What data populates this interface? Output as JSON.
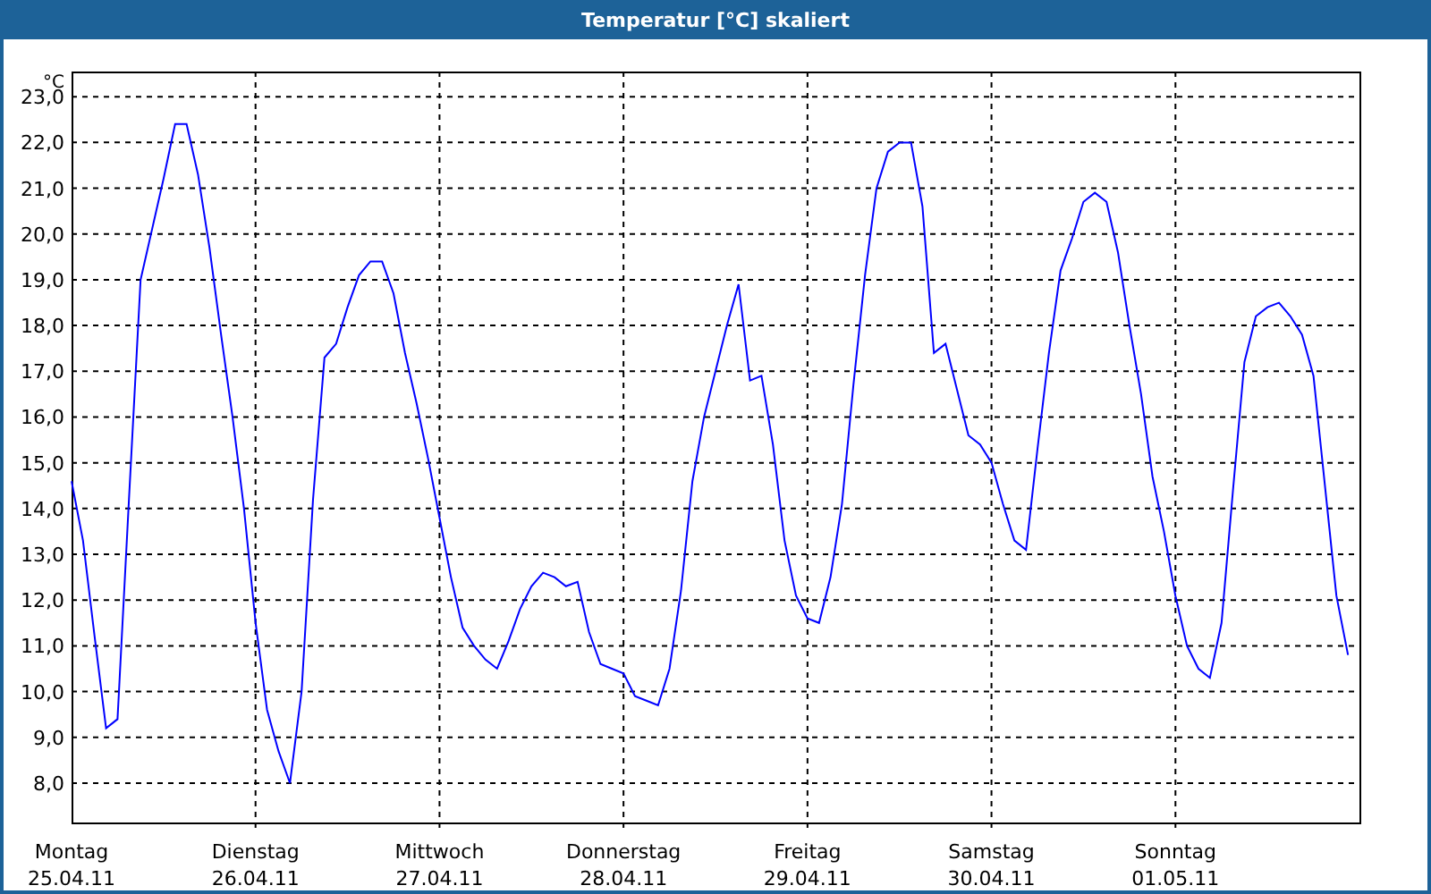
{
  "window": {
    "title": "Temperatur [°C] skaliert"
  },
  "chart": {
    "date_labels": [
      "25.04.11",
      "26.04.11",
      "27.04.11",
      "28.04.11",
      "29.04.11",
      "30.04.11",
      "01.05.11"
    ],
    "chart_data": {
      "type": "line",
      "grid": true,
      "ylabel": "°C",
      "ylim": [
        7.14,
        23.55
      ],
      "yticks": [
        {
          "value": 8,
          "label": "8,0"
        },
        {
          "value": 9,
          "label": "9,0"
        },
        {
          "value": 10,
          "label": "10,0"
        },
        {
          "value": 11,
          "label": "11,0"
        },
        {
          "value": 12,
          "label": "12,0"
        },
        {
          "value": 13,
          "label": "13,0"
        },
        {
          "value": 14,
          "label": "14,0"
        },
        {
          "value": 15,
          "label": "15,0"
        },
        {
          "value": 16,
          "label": "16,0"
        },
        {
          "value": 17,
          "label": "17,0"
        },
        {
          "value": 18,
          "label": "18,0"
        },
        {
          "value": 19,
          "label": "19,0"
        },
        {
          "value": 20,
          "label": "20,0"
        },
        {
          "value": 21,
          "label": "21,0"
        },
        {
          "value": 22,
          "label": "22,0"
        },
        {
          "value": 23,
          "label": "23,0"
        }
      ],
      "categories": [
        "Montag",
        null,
        null,
        null,
        null,
        null,
        null,
        null,
        null,
        null,
        null,
        null,
        null,
        null,
        null,
        null,
        "Dienstag",
        null,
        null,
        null,
        null,
        null,
        null,
        null,
        null,
        null,
        null,
        null,
        null,
        null,
        null,
        null,
        "Mittwoch",
        null,
        null,
        null,
        null,
        null,
        null,
        null,
        null,
        null,
        null,
        null,
        null,
        null,
        null,
        null,
        "Donnerstag",
        null,
        null,
        null,
        null,
        null,
        null,
        null,
        null,
        null,
        null,
        null,
        null,
        null,
        null,
        null,
        "Freitag",
        null,
        null,
        null,
        null,
        null,
        null,
        null,
        null,
        null,
        null,
        null,
        null,
        null,
        null,
        null,
        "Samstag",
        null,
        null,
        null,
        null,
        null,
        null,
        null,
        null,
        null,
        null,
        null,
        null,
        null,
        null,
        null,
        "Sonntag",
        null,
        null,
        null,
        null,
        null,
        null,
        null,
        null,
        null,
        null,
        null,
        null,
        null,
        null,
        null
      ],
      "series": [
        {
          "color": "#0000ff",
          "values": [
            14.6,
            13.3,
            11.2,
            9.2,
            9.4,
            14.2,
            19.0,
            20.1,
            21.2,
            22.4,
            22.4,
            21.3,
            19.7,
            17.8,
            16.0,
            14.0,
            11.5,
            9.6,
            8.7,
            8.0,
            10.0,
            14.2,
            17.3,
            17.6,
            18.4,
            19.1,
            19.4,
            19.4,
            18.7,
            17.4,
            16.3,
            15.1,
            13.8,
            12.5,
            11.4,
            11.0,
            10.7,
            10.5,
            11.1,
            11.8,
            12.3,
            12.6,
            12.5,
            12.3,
            12.4,
            11.3,
            10.6,
            10.5,
            10.4,
            9.9,
            9.8,
            9.7,
            10.5,
            12.2,
            14.6,
            16.0,
            17.0,
            18.0,
            18.9,
            16.8,
            16.9,
            15.4,
            13.3,
            12.1,
            11.6,
            11.5,
            12.5,
            14.1,
            16.7,
            19.1,
            21.0,
            21.8,
            22.0,
            22.0,
            20.6,
            17.4,
            17.6,
            16.6,
            15.6,
            15.4,
            15.0,
            14.1,
            13.3,
            13.1,
            15.3,
            17.4,
            19.2,
            19.9,
            20.7,
            20.9,
            20.7,
            19.6,
            18.0,
            16.5,
            14.7,
            13.5,
            12.1,
            11.0,
            10.5,
            10.3,
            11.5,
            14.4,
            17.2,
            18.2,
            18.4,
            18.5,
            18.2,
            17.8,
            16.9,
            14.5,
            12.1,
            10.8
          ]
        }
      ]
    }
  }
}
